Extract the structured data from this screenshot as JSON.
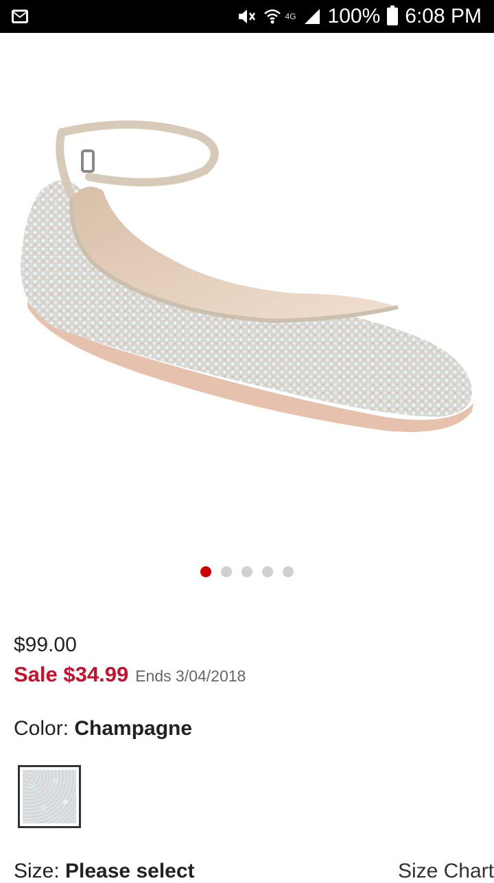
{
  "status_bar": {
    "battery": "100%",
    "time": "6:08 PM",
    "network": "4G",
    "icons": [
      "mail-icon",
      "mute-icon",
      "wifi-icon",
      "signal-icon",
      "battery-icon"
    ]
  },
  "carousel": {
    "total": 5,
    "active_index": 0
  },
  "price": {
    "original": "$99.00",
    "sale": "Sale $34.99",
    "ends": "Ends 3/04/2018"
  },
  "color": {
    "label": "Color: ",
    "value": "Champagne"
  },
  "size": {
    "label": "Size: ",
    "value": "Please select",
    "chart_link": "Size Chart"
  },
  "colors": {
    "sale_red": "#c8102e",
    "active_dot": "#cc0000",
    "inactive_dot": "#d0d0d0"
  }
}
